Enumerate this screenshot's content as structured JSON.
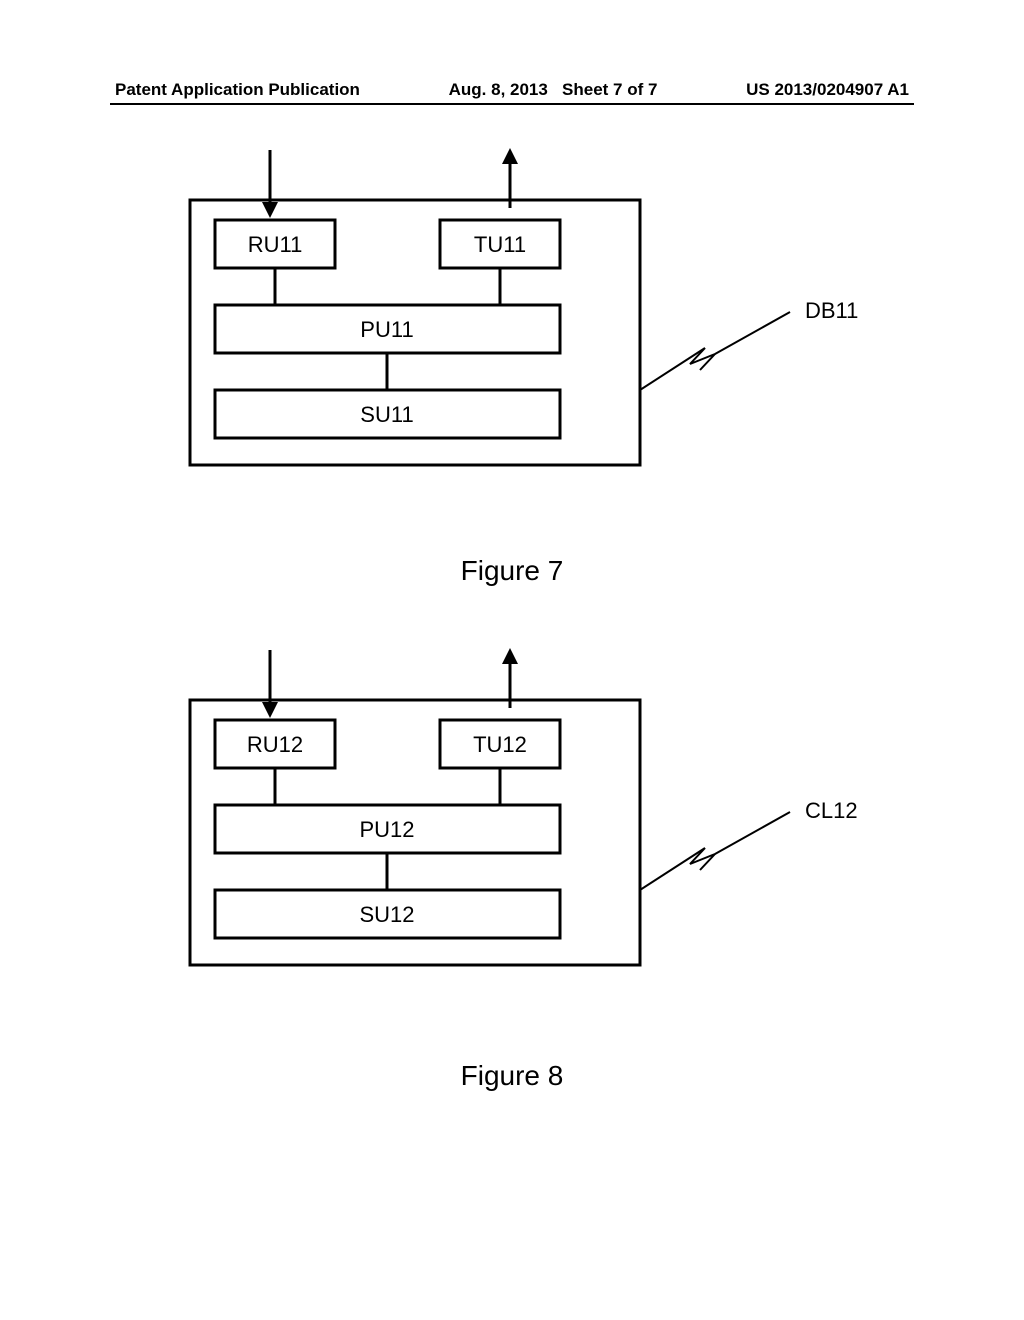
{
  "header": {
    "left": "Patent Application Publication",
    "date": "Aug. 8, 2013",
    "sheet": "Sheet 7 of 7",
    "pubno": "US 2013/0204907 A1"
  },
  "figures": {
    "fig7": {
      "caption": "Figure 7",
      "device_label": "DB11",
      "boxes": {
        "ru": "RU11",
        "tu": "TU11",
        "pu": "PU11",
        "su": "SU11"
      }
    },
    "fig8": {
      "caption": "Figure 8",
      "device_label": "CL12",
      "boxes": {
        "ru": "RU12",
        "tu": "TU12",
        "pu": "PU12",
        "su": "SU12"
      }
    }
  }
}
